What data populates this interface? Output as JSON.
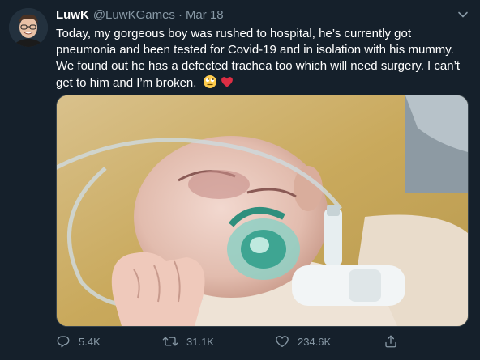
{
  "tweet": {
    "display_name": "LuwK",
    "handle": "@LuwKGames",
    "separator": "·",
    "date": "Mar 18",
    "text": "Today, my gorgeous boy was rushed to hospital, he’s currently got pneumonia and been tested for Covid-19 and in isolation with his mummy. We found out he has a defected trachea too which will need surgery. I can’t get to him and I’m broken.",
    "emojis": [
      "face-with-rolling-eyes-emoji",
      "red-heart-emoji"
    ]
  },
  "actions": {
    "replies": "5.4K",
    "retweets": "31.1K",
    "likes": "234.6K"
  },
  "icons": {
    "reply": "reply-icon",
    "retweet": "retweet-icon",
    "like": "heart-icon",
    "share": "share-icon",
    "more": "chevron-down-icon"
  },
  "colors": {
    "background": "#15202b",
    "secondary_text": "#8899a6",
    "primary_text": "#ffffff",
    "border": "#38444d"
  }
}
